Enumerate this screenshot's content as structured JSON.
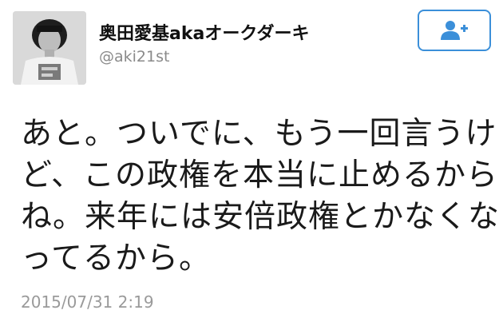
{
  "user": {
    "display_name": "奥田愛基akaオークダーキ",
    "screen_name": "@aki21st"
  },
  "follow_button": {
    "icon": "add-user-icon"
  },
  "tweet": {
    "lines": [
      "あと。ついでに、もう一回言うけ",
      "ど、この政権を本当に止めるから",
      "ね。来年には安倍政権とかなくな",
      "ってるから。"
    ],
    "timestamp": "2015/07/31 2:19"
  },
  "colors": {
    "accent": "#3b8fd9",
    "muted_text": "#8a8a8a",
    "body_text": "#1a1a1a"
  }
}
